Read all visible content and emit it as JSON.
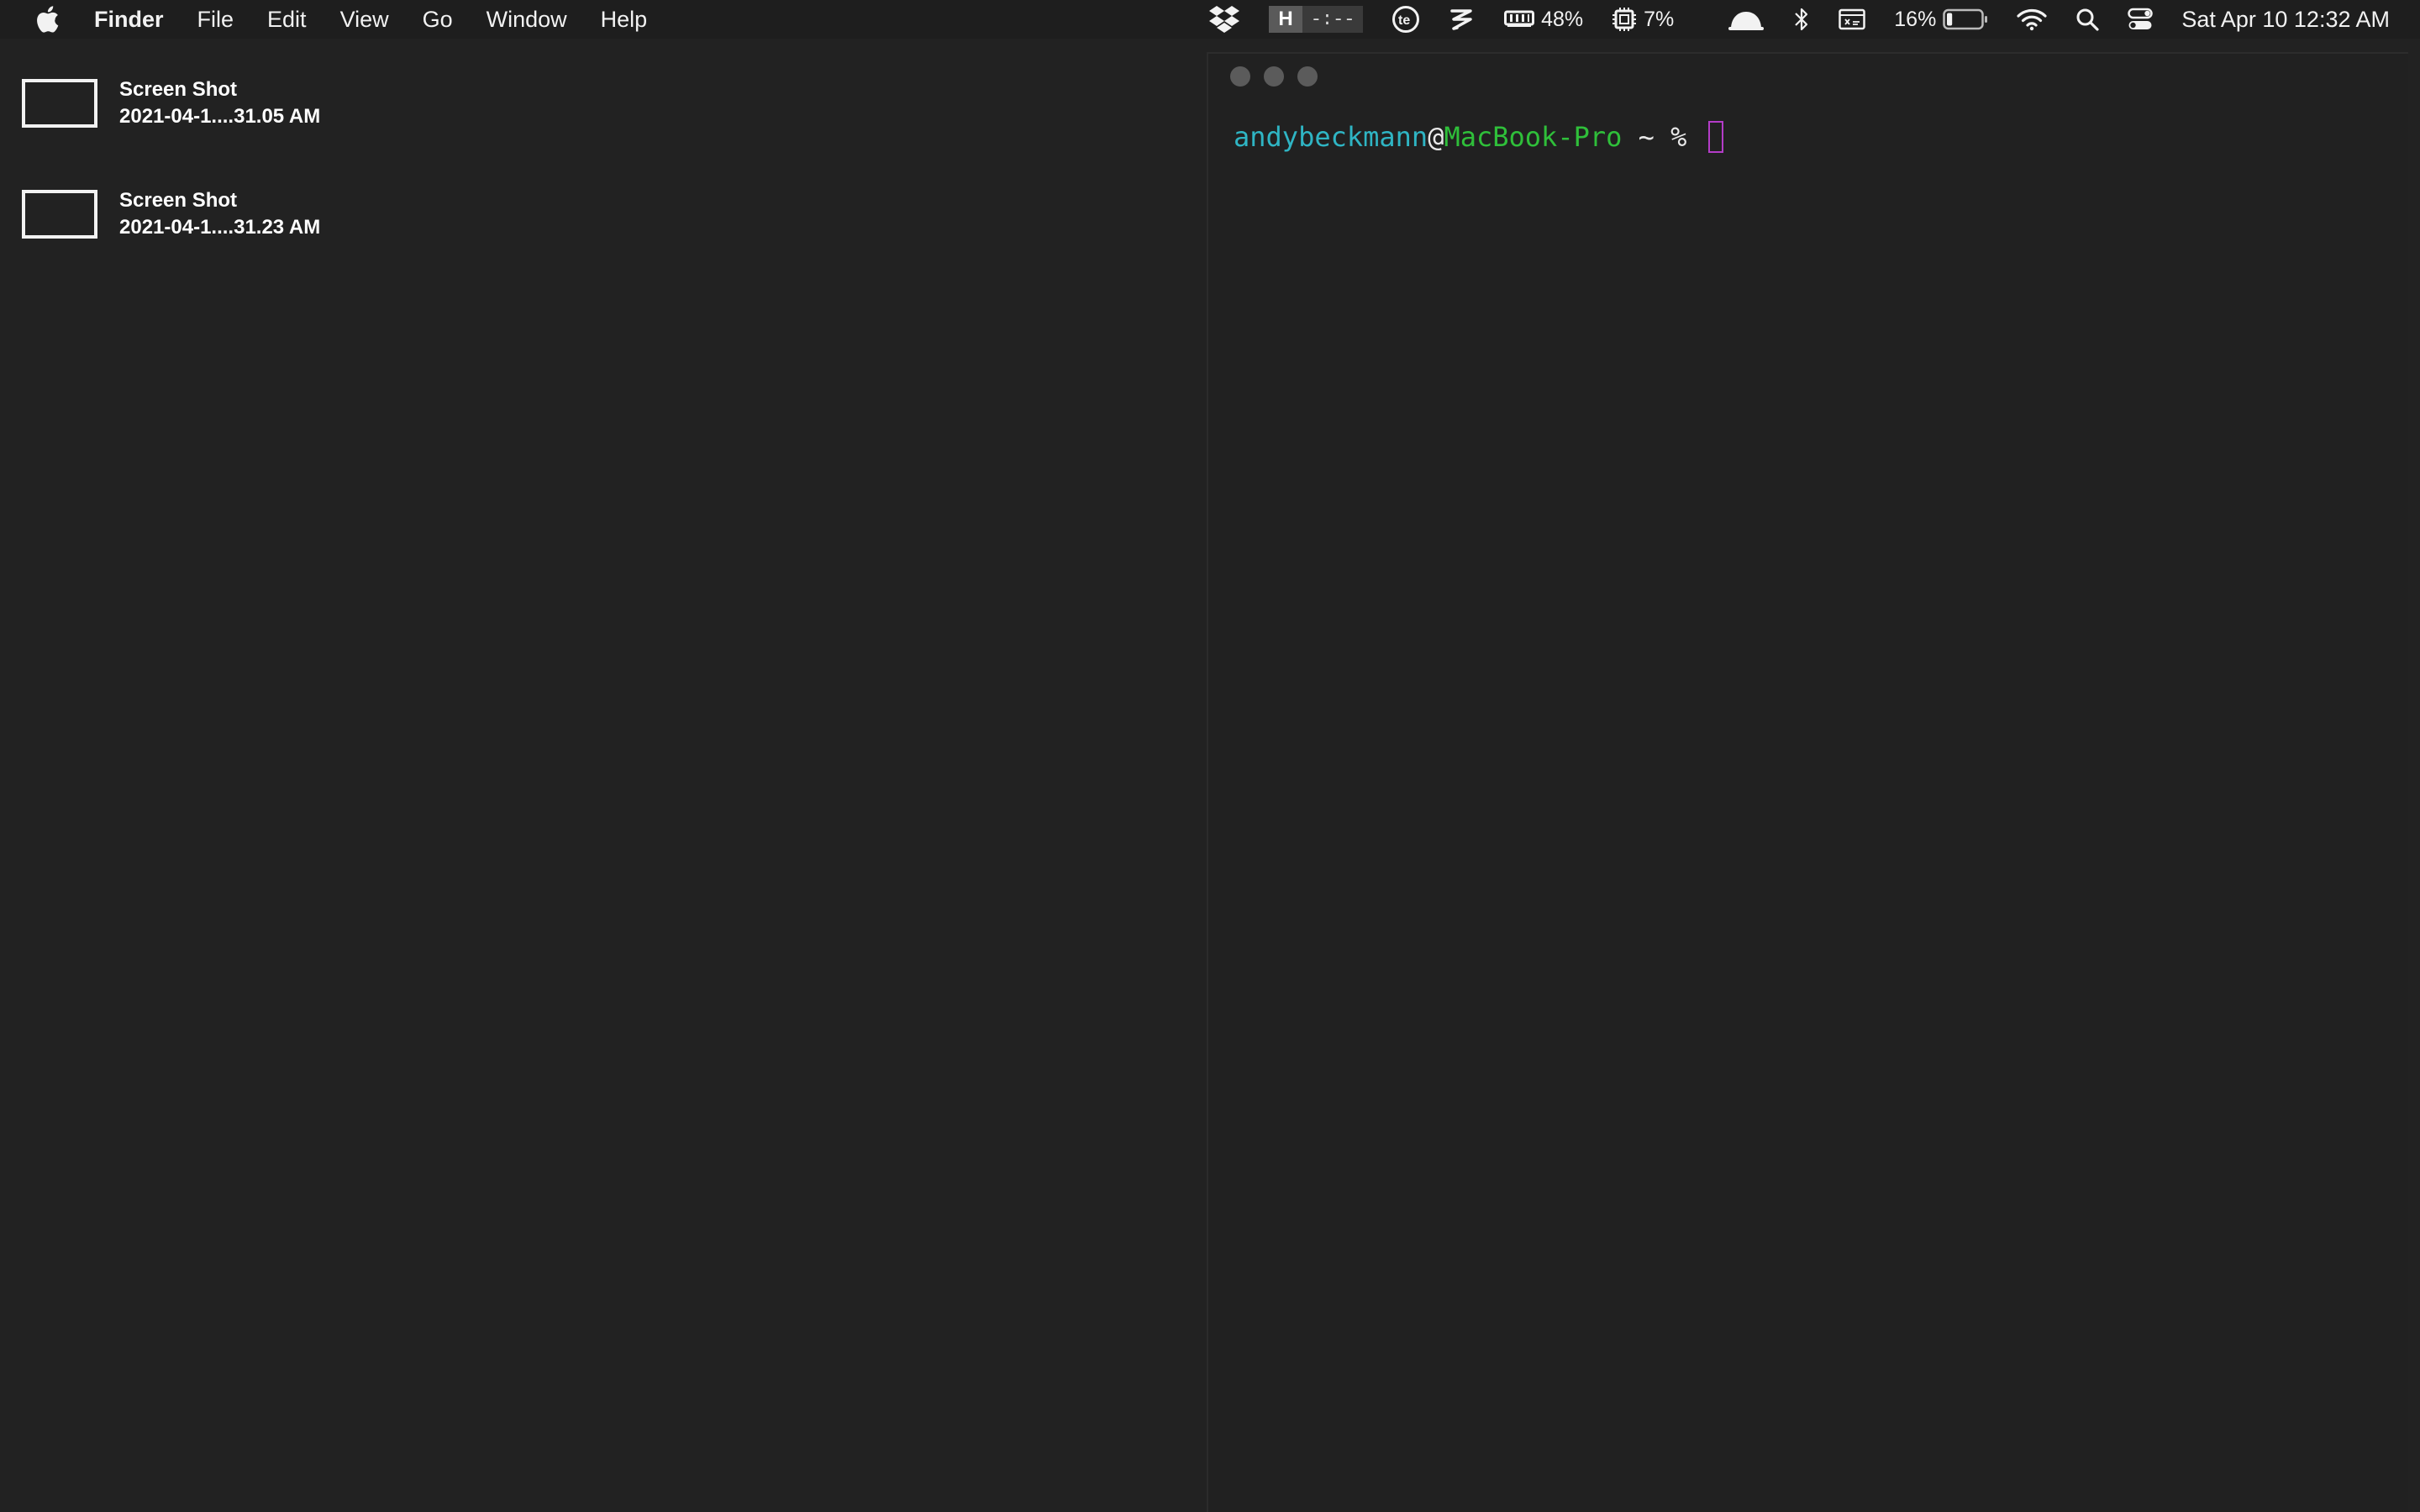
{
  "menubar": {
    "app_name": "Finder",
    "menus": [
      "File",
      "Edit",
      "View",
      "Go",
      "Window",
      "Help"
    ],
    "hbox": {
      "letter": "H",
      "time": "-:--"
    },
    "memory": {
      "value": "48%"
    },
    "cpu": {
      "value": "7%"
    },
    "battery": {
      "percent": "16%",
      "level": 0.16
    },
    "clock": "Sat Apr 10  12:32 AM"
  },
  "desktop": {
    "items": [
      {
        "line1": "Screen Shot",
        "line2": "2021-04-1....31.05 AM"
      },
      {
        "line1": "Screen Shot",
        "line2": "2021-04-1....31.23 AM"
      }
    ]
  },
  "terminal": {
    "user": "andybeckmann",
    "at": "@",
    "host": "MacBook-Pro",
    "rest": " ~ % "
  },
  "colors": {
    "background": "#222222",
    "prompt_user": "#2fb5c4",
    "prompt_host": "#2fbf3a",
    "cursor": "#b43cc8"
  }
}
